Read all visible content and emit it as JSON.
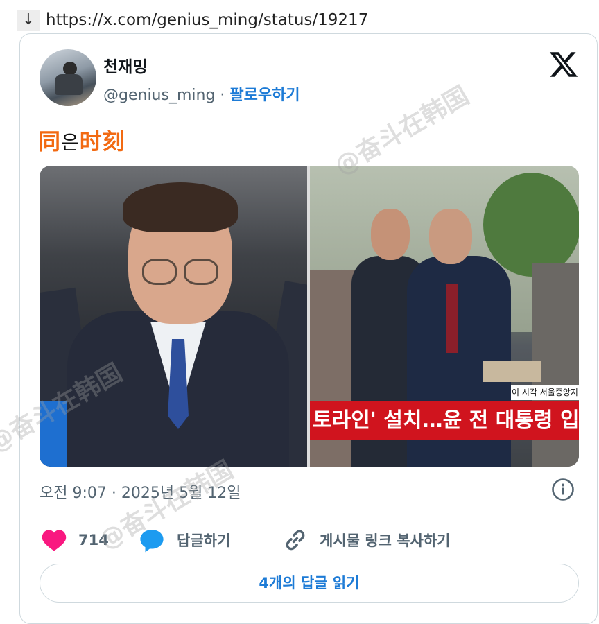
{
  "url_bar": {
    "arrow": "↓",
    "url": "https://x.com/genius_ming/status/19217"
  },
  "tweet": {
    "display_name": "천재밍",
    "handle": "@genius_ming",
    "separator": "·",
    "follow_label": "팔로우하기",
    "text_part1": "同",
    "text_mid": "은",
    "text_part2": "时刻",
    "timestamp": "오전 9:07 · 2025년 5월 12일",
    "likes": "714",
    "reply_label": "답글하기",
    "copy_link_label": "게시물 링크 복사하기",
    "read_replies_label": "4개의 답글 읽기"
  },
  "media": {
    "news_tag": "이 시각 서울중앙지",
    "news_caption": "토라인' 설치…윤 전 대통령 입"
  },
  "watermark": "@奋斗在韩国",
  "colors": {
    "accent_blue": "#1d7bd6",
    "heart_pink": "#f91880",
    "text_orange": "#f26a12",
    "news_red": "#d0141e"
  },
  "icons": [
    "x-logo-icon",
    "info-icon",
    "heart-icon",
    "reply-bubble-icon",
    "link-icon",
    "download-arrow-icon"
  ]
}
